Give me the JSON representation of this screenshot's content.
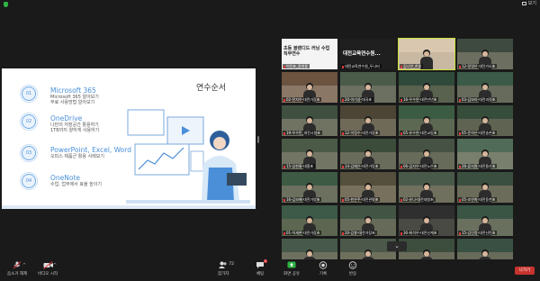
{
  "window": {
    "view_label": "보기"
  },
  "slide": {
    "title": "연수순서",
    "items": [
      {
        "num": "01",
        "heading": "Microsoft 365",
        "lines": [
          "Microsoft 365 알아보기",
          "무료 사용방법 알아보기"
        ]
      },
      {
        "num": "02",
        "heading": "OneDrive",
        "lines": [
          "나만의 저장공간 활용하기",
          "1TB까지 양하게 사용하기"
        ]
      },
      {
        "num": "03",
        "heading": "PowerPoint, Excel, Word",
        "lines": [
          "오피스 제품군 활용 사례보기"
        ]
      },
      {
        "num": "04",
        "heading": "OneNote",
        "lines": [
          "수업, 업무에서 효율 높이기"
        ]
      }
    ]
  },
  "gallery": {
    "tiles": [
      {
        "name": "이인표_중봉중",
        "kind": "title",
        "text": "초등 블렌디드 러닝 수업\n직무연수",
        "board": "#e6e6e6",
        "bg": "#f4f4f4"
      },
      {
        "name": "대전교육연수원_두나터",
        "kind": "text",
        "text": "대전교육연수원...",
        "bg": "#1f1f1f"
      },
      {
        "name": "김나연_한밭",
        "kind": "person",
        "board": "#d9c7b0",
        "bg": "#c9b9a3",
        "active": true
      },
      {
        "name": "12-정명은 대전가오초",
        "kind": "person",
        "board": "#3e4a3f",
        "bg": "#6c6f60"
      },
      {
        "name": "02-전지수-대전가장초",
        "kind": "person",
        "board": "#6b5340",
        "bg": "#8a7766"
      },
      {
        "name": "20-이기성-대곡초",
        "kind": "person",
        "board": "#4a5b4a",
        "bg": "#6b7060"
      },
      {
        "name": "16-우수연-대전만년초",
        "kind": "person",
        "board": "#2f4a3a",
        "bg": "#59614f"
      },
      {
        "name": "03-김보라-대전괴정초",
        "kind": "person",
        "board": "#3b5a47",
        "bg": "#666b5c"
      },
      {
        "name": "19-우수민_대전시청초",
        "kind": "person",
        "board": "#3f5040",
        "bg": "#707262"
      },
      {
        "name": "12-이정수-대전가장초",
        "kind": "person",
        "board": "#4c4536",
        "bg": "#6f6a58"
      },
      {
        "name": "05-유수연-대전교동초",
        "kind": "person",
        "board": "#3b5b42",
        "bg": "#5d6852"
      },
      {
        "name": "05-문하은-대전송촌초",
        "kind": "person",
        "board": "#374d3c",
        "bg": "#5f6351"
      },
      {
        "name": "15-임한울-대흥초",
        "kind": "person",
        "board": "#4b5a47",
        "bg": "#727564"
      },
      {
        "name": "14-김예은-대전가동초",
        "kind": "person",
        "board": "#3c4c3b",
        "bg": "#6a6c5b"
      },
      {
        "name": "06-김지우-대전노은초",
        "kind": "person",
        "board": "#455244",
        "bg": "#676b5a"
      },
      {
        "name": "26-류지원-대전용산초",
        "kind": "person",
        "board": "#506b57",
        "bg": "#78806d"
      },
      {
        "name": "16-김보배-대전가양초",
        "kind": "person",
        "board": "#3d5a45",
        "bg": "#6b705f"
      },
      {
        "name": "05-한은주-대전관평초",
        "kind": "person",
        "board": "#55503e",
        "bg": "#77705c"
      },
      {
        "name": "02-유나-대전대청초",
        "kind": "person",
        "board": "#4a5a4a",
        "bg": "#70705e"
      },
      {
        "name": "05-조연희-대전동천초",
        "kind": "person",
        "board": "#3a4f3f",
        "bg": "#6c6c5a"
      },
      {
        "name": "01-이세현-대전가장초",
        "kind": "person",
        "board": "#3c5a47",
        "bg": "#5c6650"
      },
      {
        "name": "20-김봉-대전가장초",
        "kind": "person",
        "board": "#425443",
        "bg": "#666a58"
      },
      {
        "name": "30-최석우-대전신계초",
        "kind": "person",
        "board": "#2f2f2f",
        "bg": "#4a4a44"
      },
      {
        "name": "15-김민정-대전신탄초",
        "kind": "person",
        "board": "#3b5545",
        "bg": "#6a705e"
      },
      {
        "name": "06-이세아-대전가동초",
        "kind": "person",
        "board": "#46594a",
        "bg": "#6d705f"
      },
      {
        "name": "06-김나윤-대전충초",
        "kind": "person",
        "board": "#4b584a",
        "bg": "#6e6f5d"
      },
      {
        "name": "15-우준-대전대덕초",
        "kind": "person",
        "board": "#3d4d3e",
        "bg": "#6a6b5a"
      },
      {
        "name": "13-정미장-대전태평초",
        "kind": "person",
        "board": "#3a5042",
        "bg": "#676b5a"
      }
    ]
  },
  "toolbar": {
    "audio_label": "음소거 해제",
    "video_label": "비디오 시작",
    "participants_label": "참가자",
    "participants_count": "72",
    "chat_label": "채팅",
    "chat_badge": "1",
    "share_label": "화면 공유",
    "record_label": "기록",
    "reactions_label": "반응",
    "leave_label": "나가기"
  },
  "colors": {
    "accent": "#4a8fd8",
    "share_green": "#2fb344",
    "leave_red": "#c8332d"
  }
}
